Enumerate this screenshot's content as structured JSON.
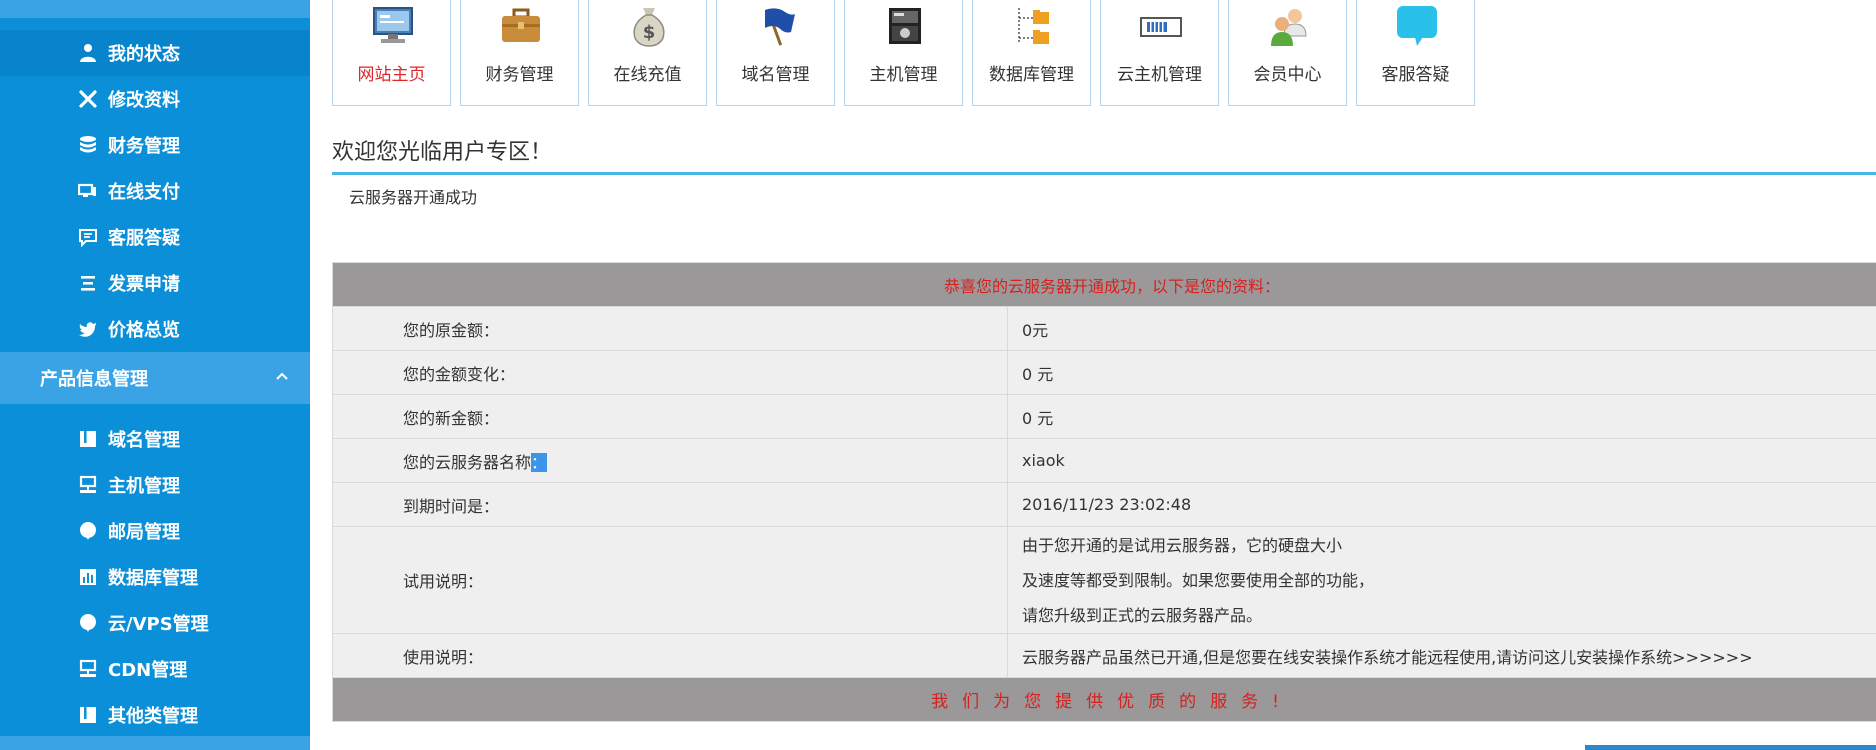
{
  "sidebar": {
    "top_group_label": "",
    "items_top": [
      {
        "label": "我的状态",
        "icon": "user-icon"
      },
      {
        "label": "修改资料",
        "icon": "tools-icon"
      },
      {
        "label": "财务管理",
        "icon": "database-icon"
      },
      {
        "label": "在线支付",
        "icon": "monitor-icon"
      },
      {
        "label": "客服答疑",
        "icon": "chat-icon"
      },
      {
        "label": "发票申请",
        "icon": "list-icon"
      },
      {
        "label": "价格总览",
        "icon": "bird-icon"
      }
    ],
    "product_group": {
      "label": "产品信息管理",
      "icon": "chevron-up-icon"
    },
    "items_product": [
      {
        "label": "域名管理",
        "icon": "book-icon"
      },
      {
        "label": "主机管理",
        "icon": "server-icon"
      },
      {
        "label": "邮局管理",
        "icon": "bubble-icon"
      },
      {
        "label": "数据库管理",
        "icon": "bar-chart-icon"
      },
      {
        "label": "云/VPS管理",
        "icon": "bubble-icon"
      },
      {
        "label": "CDN管理",
        "icon": "server-icon"
      },
      {
        "label": "其他类管理",
        "icon": "book-icon"
      }
    ]
  },
  "topnav": [
    {
      "label": "网站主页",
      "icon": "monitor-icon",
      "active": true
    },
    {
      "label": "财务管理",
      "icon": "briefcase-icon"
    },
    {
      "label": "在线充值",
      "icon": "money-bag-icon"
    },
    {
      "label": "域名管理",
      "icon": "flag-icon"
    },
    {
      "label": "主机管理",
      "icon": "server-photo-icon"
    },
    {
      "label": "数据库管理",
      "icon": "folder-tree-icon"
    },
    {
      "label": "云主机管理",
      "icon": "memory-icon"
    },
    {
      "label": "会员中心",
      "icon": "users-icon"
    },
    {
      "label": "客服答疑",
      "icon": "speech-bubble-icon"
    }
  ],
  "welcome": {
    "title": "欢迎您光临用户专区！",
    "status": "云服务器开通成功"
  },
  "info": {
    "header": "恭喜您的云服务器开通成功，以下是您的资料：",
    "rows": [
      {
        "label": "您的原金额：",
        "value": "0元"
      },
      {
        "label": "您的金额变化：",
        "value": "0 元"
      },
      {
        "label": "您的新金额：",
        "value": "0 元"
      },
      {
        "label_main": "您的云服务器名称",
        "label_highlight": "：",
        "value": "xiaok"
      },
      {
        "label": "到期时间是：",
        "value": "2016/11/23 23:02:48"
      }
    ],
    "trial_label": "试用说明：",
    "trial_lines": [
      "由于您开通的是试用云服务器，它的硬盘大小",
      "及速度等都受到限制。如果您要使用全部的功能，",
      "请您升级到正式的云服务器产品。"
    ],
    "usage_label": "使用说明：",
    "usage_text": "云服务器产品虽然已开通,但是您要在线安装操作系统才能远程使用,请访问这儿安装操作系统>>>>>>",
    "footer": "我们为您提供优质的服务!"
  },
  "colors": {
    "sidebar_bg": "#0a8fd8",
    "sidebar_group_bg": "#3aa3e6",
    "table_header_bg": "#9a9899",
    "table_header_text": "#d8211f",
    "accent_line": "#4ab3e8",
    "nav_active_text": "#e0262a"
  }
}
